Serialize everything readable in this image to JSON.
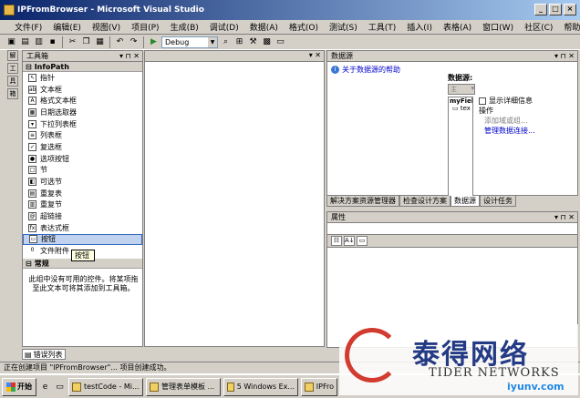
{
  "window": {
    "title": "IPFromBrowser - Microsoft Visual Studio",
    "min": "_",
    "max": "□",
    "close": "×"
  },
  "menu": [
    "文件(F)",
    "编辑(E)",
    "视图(V)",
    "项目(P)",
    "生成(B)",
    "调试(D)",
    "数据(A)",
    "格式(O)",
    "测试(S)",
    "工具(T)",
    "插入(I)",
    "表格(A)",
    "窗口(W)",
    "社区(C)",
    "帮助(H)"
  ],
  "toolbar": {
    "config": "Debug"
  },
  "left_strip": [
    "解",
    "工",
    "具",
    "箱"
  ],
  "toolbox": {
    "title": "工具箱",
    "section": "InfoPath",
    "items": [
      {
        "label": "指针",
        "icon": "pointer-icon",
        "glyph": "↖"
      },
      {
        "label": "文本框",
        "icon": "textbox-icon",
        "glyph": "ab"
      },
      {
        "label": "格式文本框",
        "icon": "richtext-icon",
        "glyph": "A"
      },
      {
        "label": "日期选取器",
        "icon": "date-picker-icon",
        "glyph": "▦"
      },
      {
        "label": "下拉列表框",
        "icon": "dropdown-icon",
        "glyph": "▾"
      },
      {
        "label": "列表框",
        "icon": "listbox-icon",
        "glyph": "≡"
      },
      {
        "label": "复选框",
        "icon": "checkbox-icon",
        "glyph": "✓"
      },
      {
        "label": "选项按钮",
        "icon": "radio-icon",
        "glyph": "●"
      },
      {
        "label": "节",
        "icon": "section-icon",
        "glyph": "□"
      },
      {
        "label": "可选节",
        "icon": "optional-section-icon",
        "glyph": "◧"
      },
      {
        "label": "重复表",
        "icon": "repeating-table-icon",
        "glyph": "▤"
      },
      {
        "label": "重复节",
        "icon": "repeating-section-icon",
        "glyph": "▥"
      },
      {
        "label": "超链接",
        "icon": "hyperlink-icon",
        "glyph": "@"
      },
      {
        "label": "表达式框",
        "icon": "expression-icon",
        "glyph": "fx"
      },
      {
        "label": "按钮",
        "icon": "button-icon",
        "glyph": "▭"
      },
      {
        "label": "文件附件",
        "icon": "attachment-icon",
        "glyph": "0"
      }
    ],
    "tooltip": "按钮",
    "general": "常规",
    "empty_msg": "此组中没有可用的控件。将某项拖至此文本可将其添加到工具箱。"
  },
  "datasource": {
    "title": "数据源",
    "help": "关于数据源的帮助",
    "label": "数据源:",
    "combo": "主",
    "tree_root": "myFiel",
    "tree_child": "tex",
    "show_details": "显示详细信息",
    "ops": "操作",
    "add_field": "添加域或组...",
    "manage": "管理数据连接..."
  },
  "right_tabs": [
    "解决方案资源管理器",
    "检查设计方案",
    "数据源",
    "设计任务"
  ],
  "props": {
    "title": "属性"
  },
  "error_tab": "错误列表",
  "status": "正在创建项目 \"IPFromBrowser\"... 项目创建成功。",
  "taskbar": {
    "start": "开始",
    "tasks": [
      "testCode - Mi...",
      "管理表单模板 ...",
      "5 Windows Ex...",
      "IPFro"
    ]
  },
  "watermark": {
    "cn": "泰得网络",
    "en": "TIDER NETWORKS",
    "url": "iyunv.com"
  },
  "colors": {
    "title_start": "#0a246a",
    "title_end": "#a6caf0",
    "selection": "#c1d2ee",
    "link": "#0000cc"
  }
}
